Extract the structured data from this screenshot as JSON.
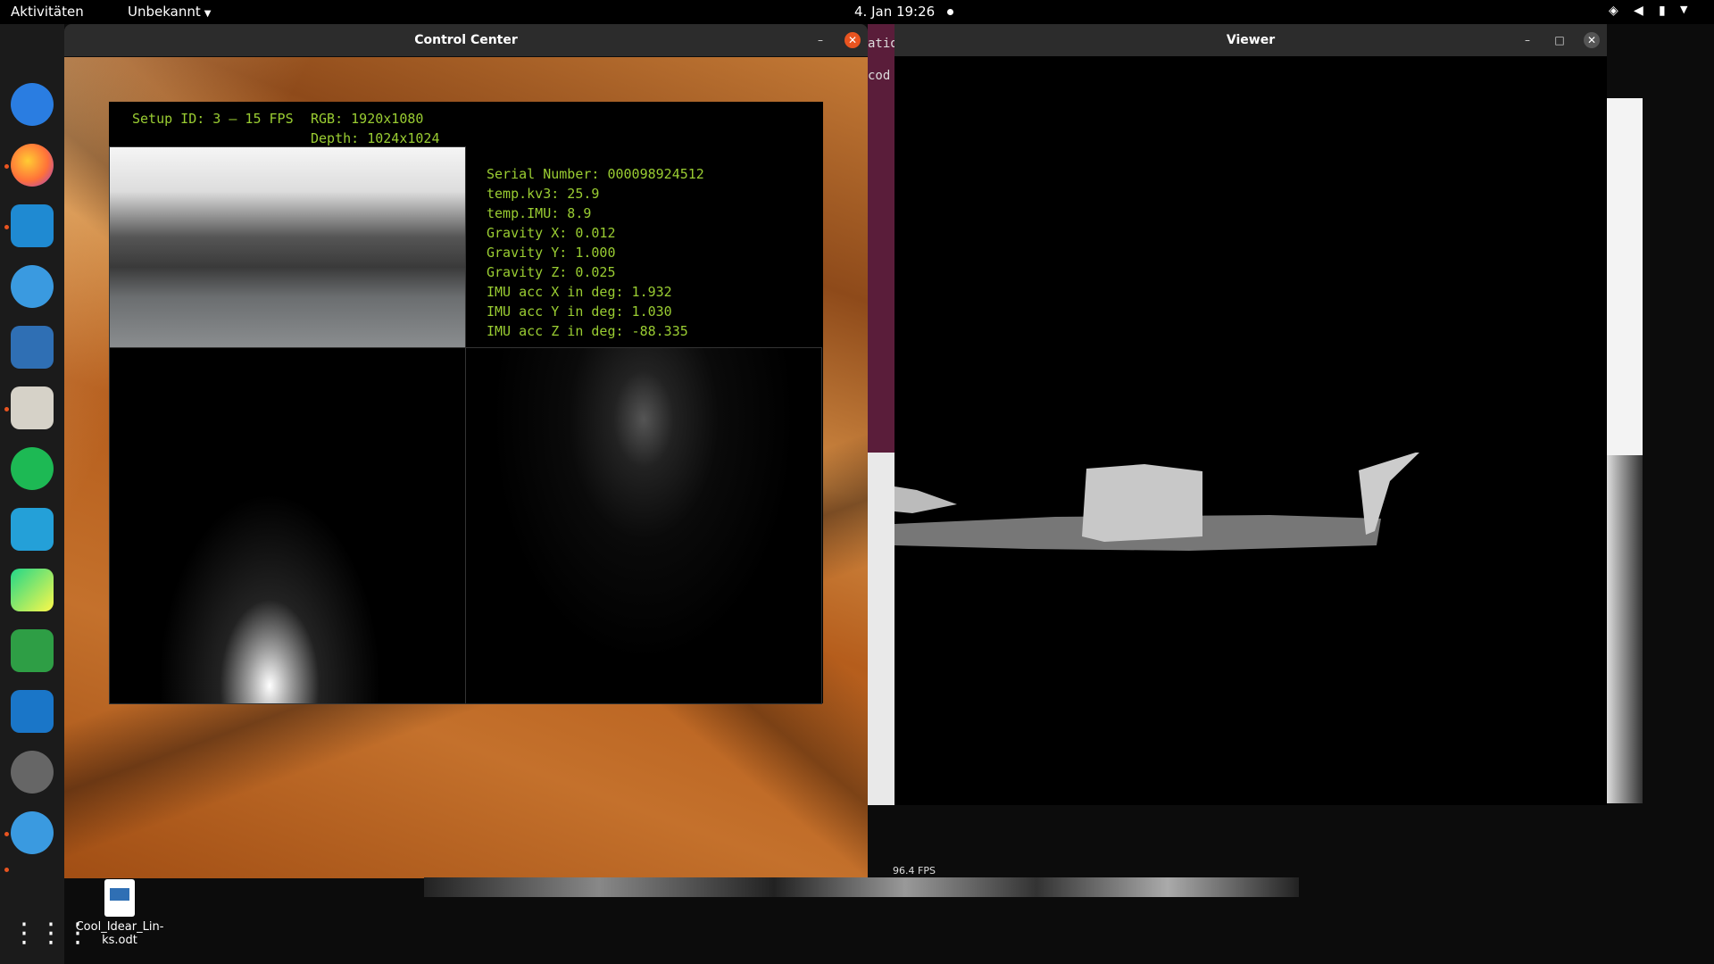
{
  "topbar": {
    "activities": "Aktivitäten",
    "app_menu": "Unbekannt",
    "clock": "4. Jan  19:26"
  },
  "dock": {
    "items": [
      {
        "name": "thunderbird",
        "color": "#2a7de1"
      },
      {
        "name": "firefox",
        "color": "#ff7139"
      },
      {
        "name": "vscode",
        "color": "#1f8ad2"
      },
      {
        "name": "remmina",
        "color": "#3a9ae0"
      },
      {
        "name": "libreoffice-writer",
        "color": "#2f6fb4"
      },
      {
        "name": "files",
        "color": "#d6d2c8"
      },
      {
        "name": "spotify",
        "color": "#1db954"
      },
      {
        "name": "vscode-insiders",
        "color": "#24a0d8"
      },
      {
        "name": "pycharm",
        "color": "#21d789"
      },
      {
        "name": "libreoffice-calc",
        "color": "#2e9e45"
      },
      {
        "name": "system-monitor",
        "color": "#1a76c8"
      },
      {
        "name": "steam",
        "color": "#666666"
      },
      {
        "name": "remmina-2",
        "color": "#3a9ae0"
      }
    ],
    "show_apps_icon": "grid-icon"
  },
  "desktop_file": {
    "label": "Cool_Idear_Lin-ks.odt"
  },
  "background_window": {
    "text1": "ation",
    "text2": "cod",
    "fps": "96.4 FPS"
  },
  "control_center": {
    "title": "Control Center",
    "header": {
      "setup": "Setup ID: 3 – 15 FPS",
      "rgb": "RGB: 1920x1080",
      "depth": "Depth: 1024x1024"
    },
    "info_lines": [
      "Serial Number: 000098924512",
      "temp.kv3: 25.9",
      "temp.IMU: 8.9",
      "Gravity X: 0.012",
      "Gravity Y: 1.000",
      "Gravity Z: 0.025",
      "IMU acc X in deg: 1.932",
      "IMU acc Y in deg: 1.030",
      "IMU acc Z in deg: -88.335"
    ]
  },
  "viewer": {
    "title": "Viewer"
  }
}
